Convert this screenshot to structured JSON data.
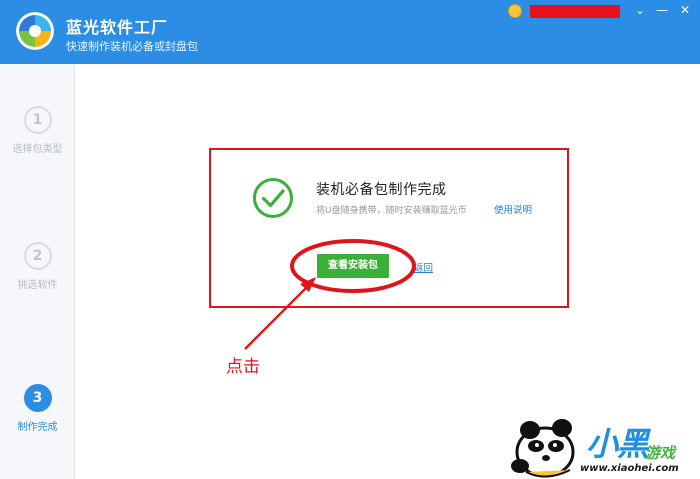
{
  "app": {
    "title": "蓝光软件工厂",
    "subtitle": "快速制作装机必备或封盘包"
  },
  "window_controls": {
    "menu_glyph": "⌄",
    "minimize_glyph": "—",
    "close_glyph": "✕"
  },
  "steps": [
    {
      "number": "1",
      "label": "选择包类型",
      "state": "done"
    },
    {
      "number": "2",
      "label": "挑选软件",
      "state": "done"
    },
    {
      "number": "3",
      "label": "制作完成",
      "state": "active"
    }
  ],
  "result": {
    "title": "装机必备包制作完成",
    "subtitle": "将U盘随身携带，随时安装赚取蓝光币",
    "help_link": "使用说明",
    "view_button": "查看安装包",
    "back_link": "返回"
  },
  "annotation": {
    "click_note": "点击",
    "color": "#e0141b"
  },
  "watermark": {
    "brand_main": "小黑",
    "brand_sub": "游戏",
    "url": "www.xiaohei.com"
  },
  "colors": {
    "header": "#2b8ee4",
    "accent": "#2b8ee4",
    "success": "#3ab03a",
    "annotation": "#e0141b"
  }
}
